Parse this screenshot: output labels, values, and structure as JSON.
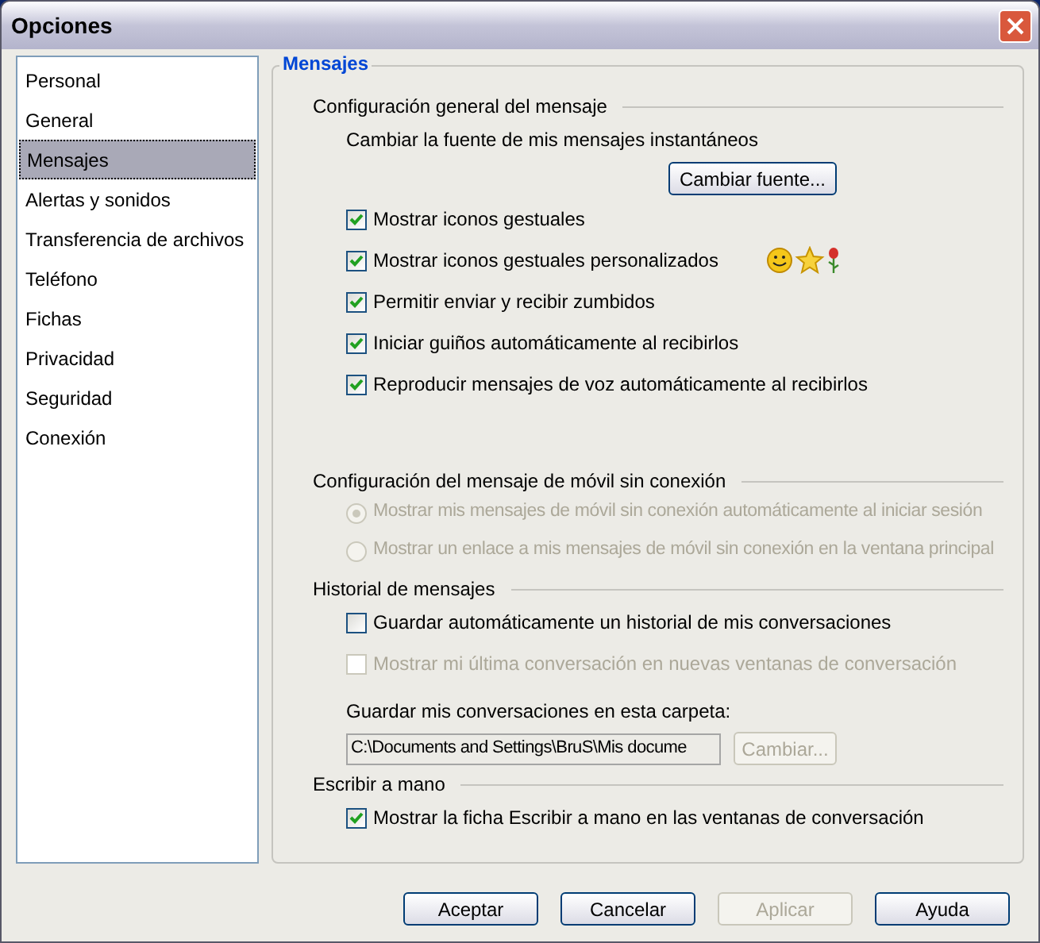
{
  "window": {
    "title": "Opciones"
  },
  "sidebar": {
    "items": [
      {
        "label": "Personal",
        "selected": false
      },
      {
        "label": "General",
        "selected": false
      },
      {
        "label": "Mensajes",
        "selected": true
      },
      {
        "label": "Alertas y sonidos",
        "selected": false
      },
      {
        "label": "Transferencia de archivos",
        "selected": false
      },
      {
        "label": "Teléfono",
        "selected": false
      },
      {
        "label": "Fichas",
        "selected": false
      },
      {
        "label": "Privacidad",
        "selected": false
      },
      {
        "label": "Seguridad",
        "selected": false
      },
      {
        "label": "Conexión",
        "selected": false
      }
    ]
  },
  "panel": {
    "title": "Mensajes",
    "sections": [
      {
        "title": "Configuración general del mensaje",
        "items": [
          {
            "kind": "label",
            "text": "Cambiar la fuente de mis mensajes instantáneos"
          },
          {
            "kind": "button",
            "label": "Cambiar fuente...",
            "disabled": false
          },
          {
            "kind": "checkbox",
            "label": "Mostrar iconos gestuales",
            "checked": true,
            "disabled": false
          },
          {
            "kind": "checkbox_icons",
            "label": "Mostrar iconos gestuales personalizados",
            "checked": true,
            "disabled": false
          },
          {
            "kind": "checkbox",
            "label": "Permitir enviar y recibir zumbidos",
            "checked": true,
            "disabled": false
          },
          {
            "kind": "checkbox",
            "label": "Iniciar guiños automáticamente al recibirlos",
            "checked": true,
            "disabled": false
          },
          {
            "kind": "checkbox",
            "label": "Reproducir mensajes de voz automáticamente al recibirlos",
            "checked": true,
            "disabled": false
          }
        ]
      },
      {
        "title": "Configuración del mensaje de móvil sin conexión",
        "items": [
          {
            "kind": "radio",
            "label": "Mostrar mis mensajes de móvil sin conexión automáticamente al iniciar sesión",
            "selected": true,
            "disabled": true
          },
          {
            "kind": "radio",
            "label": "Mostrar un enlace a mis mensajes de móvil sin conexión en la ventana principal",
            "selected": false,
            "disabled": true
          }
        ]
      },
      {
        "title": "Historial de mensajes",
        "items": [
          {
            "kind": "checkbox",
            "label": "Guardar automáticamente un historial de mis conversaciones",
            "checked": false,
            "disabled": false
          },
          {
            "kind": "checkbox",
            "label": "Mostrar mi última conversación en nuevas ventanas de conversación",
            "checked": false,
            "disabled": true
          },
          {
            "kind": "folder",
            "text": "Guardar mis conversaciones en esta carpeta:",
            "value": "C:\\Documents and Settings\\BruS\\Mis docume",
            "button": "Cambiar...",
            "disabled": true
          }
        ]
      },
      {
        "title": "Escribir a mano",
        "items": [
          {
            "kind": "checkbox",
            "label": "Mostrar la ficha Escribir a mano en las ventanas de conversación",
            "checked": true,
            "disabled": false
          }
        ]
      }
    ]
  },
  "buttons": [
    {
      "label": "Aceptar",
      "disabled": false
    },
    {
      "label": "Cancelar",
      "disabled": false
    },
    {
      "label": "Aplicar",
      "disabled": true
    },
    {
      "label": "Ayuda",
      "disabled": false
    }
  ]
}
